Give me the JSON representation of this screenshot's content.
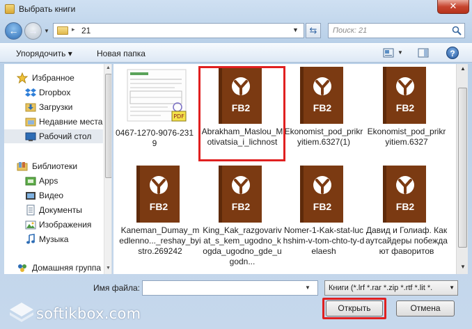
{
  "window": {
    "title": "Выбрать книги",
    "close_glyph": "✕"
  },
  "address": {
    "path_arrow": "▸",
    "path": "21",
    "search_placeholder": "Поиск: 21"
  },
  "toolbar": {
    "organize_label": "Упорядочить ▾",
    "new_folder_label": "Новая папка",
    "help_glyph": "?"
  },
  "sidebar": {
    "items": [
      {
        "label": "Избранное",
        "icon": "star-icon"
      },
      {
        "label": "Dropbox",
        "icon": "dropbox-icon"
      },
      {
        "label": "Загрузки",
        "icon": "downloads-folder-icon"
      },
      {
        "label": "Недавние места",
        "icon": "recent-places-icon"
      },
      {
        "label": "Рабочий стол",
        "icon": "desktop-icon",
        "selected": true
      },
      {
        "label": "Библиотеки",
        "icon": "libraries-icon"
      },
      {
        "label": "Apps",
        "icon": "apps-icon"
      },
      {
        "label": "Видео",
        "icon": "video-icon"
      },
      {
        "label": "Документы",
        "icon": "documents-icon"
      },
      {
        "label": "Изображения",
        "icon": "images-icon"
      },
      {
        "label": "Музыка",
        "icon": "music-icon"
      },
      {
        "label": "Домашняя группа",
        "icon": "homegroup-icon"
      }
    ]
  },
  "files": [
    {
      "name": "0467-1270-9076-2319",
      "type": "pdf-thumbnail"
    },
    {
      "name": "Abrakham_Maslou_Motivatsia_i_lichnost",
      "type": "fb2",
      "highlighted": true
    },
    {
      "name": "Ekonomist_pod_prikryitiem.6327(1)",
      "type": "fb2"
    },
    {
      "name": "Ekonomist_pod_prikryitiem.6327",
      "type": "fb2"
    },
    {
      "name": "Kaneman_Dumay_medlenno..._reshay_byistro.269242",
      "type": "fb2"
    },
    {
      "name": "King_Kak_razgovarivat_s_kem_ugodno_kogda_ugodno_gde_ugodn...",
      "type": "fb2"
    },
    {
      "name": "Nomer-1-Kak-stat-luchshim-v-tom-chto-ty-delaesh",
      "type": "fb2"
    },
    {
      "name": "Давид и Голиаф. Как аутсайдеры побеждают фаворитов",
      "type": "fb2"
    }
  ],
  "fb2_label": "FB2",
  "bottom": {
    "filename_label": "Имя файла:",
    "filename_value": "",
    "filter_value": "Книги (*.lrf *.rar *.zip *.rtf *.lit *.",
    "open_label": "Открыть",
    "cancel_label": "Отмена"
  },
  "watermark": {
    "text": "softikbox.com"
  },
  "colors": {
    "fb2_book": "#7b3a12",
    "highlight": "#e02020",
    "accent": "#2e6db5"
  }
}
